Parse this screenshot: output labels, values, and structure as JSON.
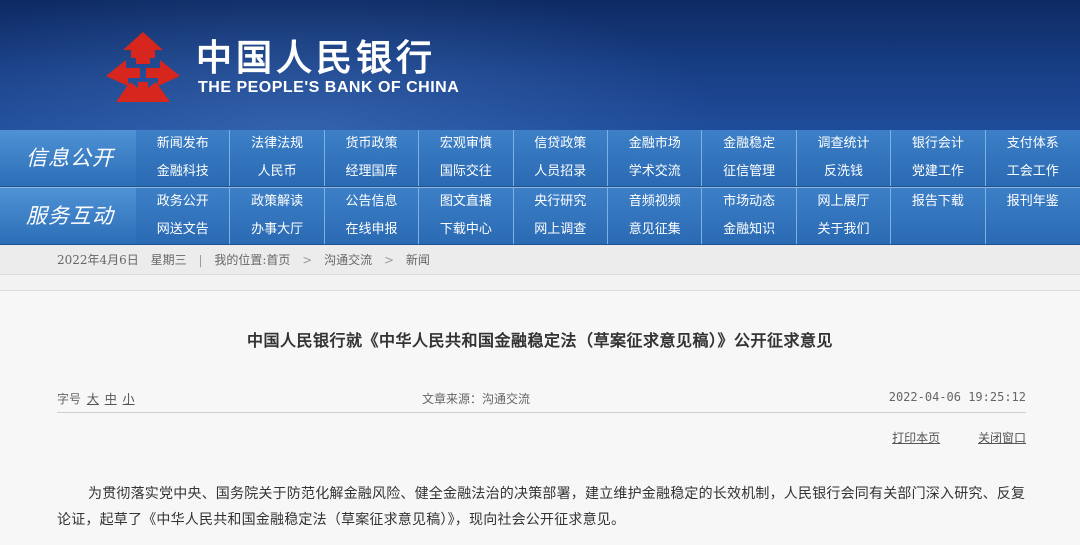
{
  "header": {
    "name_cn": "中国人民银行",
    "name_en": "THE PEOPLE'S BANK OF CHINA"
  },
  "nav_info": {
    "label": "信息公开",
    "items": [
      "新闻发布",
      "法律法规",
      "货币政策",
      "宏观审慎",
      "信贷政策",
      "金融市场",
      "金融稳定",
      "调查统计",
      "银行会计",
      "支付体系",
      "金融科技",
      "人民币",
      "经理国库",
      "国际交往",
      "人员招录",
      "学术交流",
      "征信管理",
      "反洗钱",
      "党建工作",
      "工会工作"
    ]
  },
  "nav_service": {
    "label": "服务互动",
    "items": [
      "政务公开",
      "政策解读",
      "公告信息",
      "图文直播",
      "央行研究",
      "音频视频",
      "市场动态",
      "网上展厅",
      "报告下载",
      "报刊年鉴",
      "网送文告",
      "办事大厅",
      "在线申报",
      "下载中心",
      "网上调查",
      "意见征集",
      "金融知识",
      "关于我们",
      "",
      ""
    ]
  },
  "breadcrumb": {
    "date": "2022年4月6日",
    "weekday": "星期三",
    "sep": "|",
    "location_label": "我的位置:首页",
    "arrow": ">",
    "level1": "沟通交流",
    "level2": "新闻"
  },
  "article": {
    "title": "中国人民银行就《中华人民共和国金融稳定法（草案征求意见稿）》公开征求意见",
    "font_size_label": "字号",
    "font_large": "大",
    "font_medium": "中",
    "font_small": "小",
    "source": "文章来源：沟通交流",
    "datetime": "2022-04-06 19:25:12",
    "print_label": "打印本页",
    "close_label": "关闭窗口",
    "body": "为贯彻落实党中央、国务院关于防范化解金融风险、健全金融法治的决策部署，建立维护金融稳定的长效机制，人民银行会同有关部门深入研究、反复论证，起草了《中华人民共和国金融稳定法（草案征求意见稿）》，现向社会公开征求意见。"
  },
  "colors": {
    "header_bg": "#163a7c",
    "nav_bg": "#2f70b8",
    "logo_red": "#d7261e"
  },
  "icons": {
    "logo": "pboc-emblem-icon"
  }
}
